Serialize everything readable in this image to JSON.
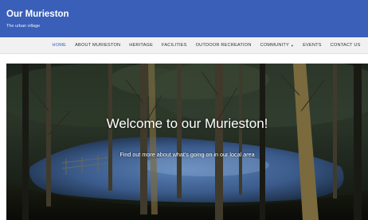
{
  "site": {
    "title": "Our Murieston",
    "tagline": "The urban village"
  },
  "nav": {
    "items": [
      {
        "label": "HOME",
        "active": true
      },
      {
        "label": "ABOUT MURIESTON"
      },
      {
        "label": "HERITAGE"
      },
      {
        "label": "FACILITIES"
      },
      {
        "label": "OUTDOOR RECREATION"
      },
      {
        "label": "COMMUNITY",
        "dropdown": true,
        "icon": "chevron-down-icon"
      },
      {
        "label": "EVENTS"
      },
      {
        "label": "CONTACT US"
      }
    ]
  },
  "hero": {
    "heading": "Welcome to our Murieston!",
    "subheading": "Find out more about what's going on in our local area"
  },
  "colors": {
    "header": "#3a5fb8",
    "nav_bg": "#f1f1f1",
    "nav_active": "#3a5fb8"
  }
}
